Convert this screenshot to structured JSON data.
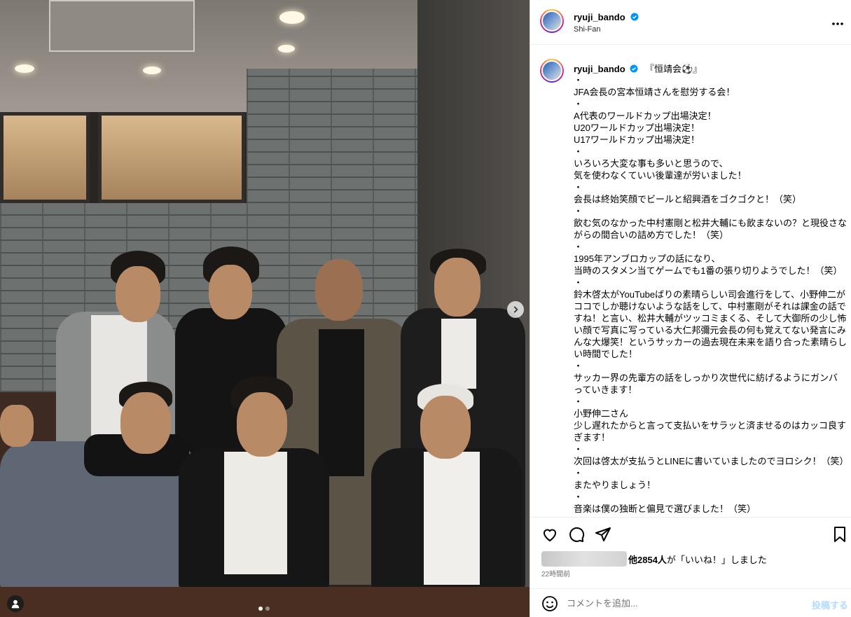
{
  "header": {
    "username": "ryuji_bando",
    "location": "Shi-Fan",
    "more_icon": "more-horizontal-icon"
  },
  "caption": {
    "username": "ryuji_bando",
    "title": "『恒靖会⚽』",
    "lines": [
      "・",
      "JFA会長の宮本恒靖さんを慰労する会！",
      "・",
      "A代表のワールドカップ出場決定！",
      "U20ワールドカップ出場決定！",
      "U17ワールドカップ出場決定！",
      "・",
      "いろいろ大変な事も多いと思うので、",
      "気を使わなくていい後輩達が労いました！",
      "・",
      "会長は終始笑顔でビールと紹興酒をゴクゴクと！（笑）",
      "・",
      "飲む気のなかった中村憲剛と松井大輔にも飲まないの？と現役さながらの間合いの詰め方でした！（笑）",
      "・",
      "1995年アンブロカップの話になり、",
      "当時のスタメン当てゲームでも1番の張り切りようでした！（笑）",
      "・",
      "鈴木啓太がYouTubeばりの素晴らしい司会進行をして、小野伸二がココでしか聴けないような話をして、中村憲剛がそれは課金の話ですね！と言い、松井大輔がツッコミまくる、そして大御所の少し怖い顔で写真に写っている大仁邦彌元会長の何も覚えてない発言にみんな大爆笑！というサッカーの過去現在未来を語り合った素晴らしい時間でした！",
      "・",
      "サッカー界の先輩方の話をしっかり次世代に紡げるようにガンバっていきます！",
      "・",
      "小野伸二さん",
      "少し遅れたからと言って支払いをサラッと済ませるのはカッコ良すぎます！",
      "・",
      "次回は啓太が支払うとLINEに書いていましたのでヨロシク！（笑）",
      "・",
      "またやりましょう！",
      "・",
      "音楽は僕の独断と偏見で選びました！（笑）"
    ]
  },
  "actions": {
    "like_icon": "heart-icon",
    "comment_icon": "comment-icon",
    "share_icon": "send-icon",
    "save_icon": "bookmark-icon"
  },
  "likes": {
    "bold": "他2854人",
    "rest": "が「いいね！」しました"
  },
  "timestamp": "22時間前",
  "comment": {
    "placeholder": "コメントを追加...",
    "post_label": "投稿する"
  },
  "carousel": {
    "dot_count": 2,
    "active_index": 0
  },
  "colors": {
    "verified": "#0095f6",
    "post_disabled": "#b3dbff"
  }
}
